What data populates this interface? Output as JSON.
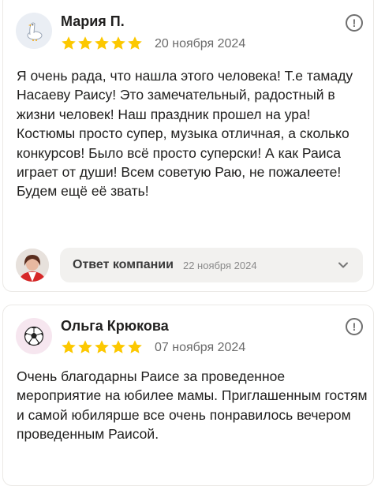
{
  "reviews": [
    {
      "author": "Мария П.",
      "avatar_icon": "goose-icon",
      "rating": 5,
      "date": "20 ноября 2024",
      "text": "Я очень рада, что нашла этого человека! Т.е тамаду Насаеву Раису! Это замечательный, радостный в жизни человек! Наш праздник прошел на ура! Костюмы просто супер, музыка отличная, а сколько конкурсов! Было всё просто суперски! А как Раиса играет от души! Всем советую Раю, не пожалеете! Будем ещё её звать!",
      "reply": {
        "label": "Ответ компании",
        "date": "22 ноября 2024"
      }
    },
    {
      "author": "Ольга Крюкова",
      "avatar_icon": "soccer-ball-icon",
      "rating": 5,
      "date": "07 ноября 2024",
      "text": "Очень благодарны Раисе за проведенное мероприятие на юбилее мамы. Приглашенным гостям и самой юбилярше все очень понравилось вечером проведенным Раисой."
    }
  ],
  "colors": {
    "star": "#fcc800",
    "card_border": "#ebe9e6",
    "pill_bg": "#f2f1ef",
    "avatar1_bg": "#eaeef4",
    "avatar2_bg": "#f6e6ef"
  },
  "icons": {
    "more": "!",
    "chevron": "chevron-down-icon"
  }
}
